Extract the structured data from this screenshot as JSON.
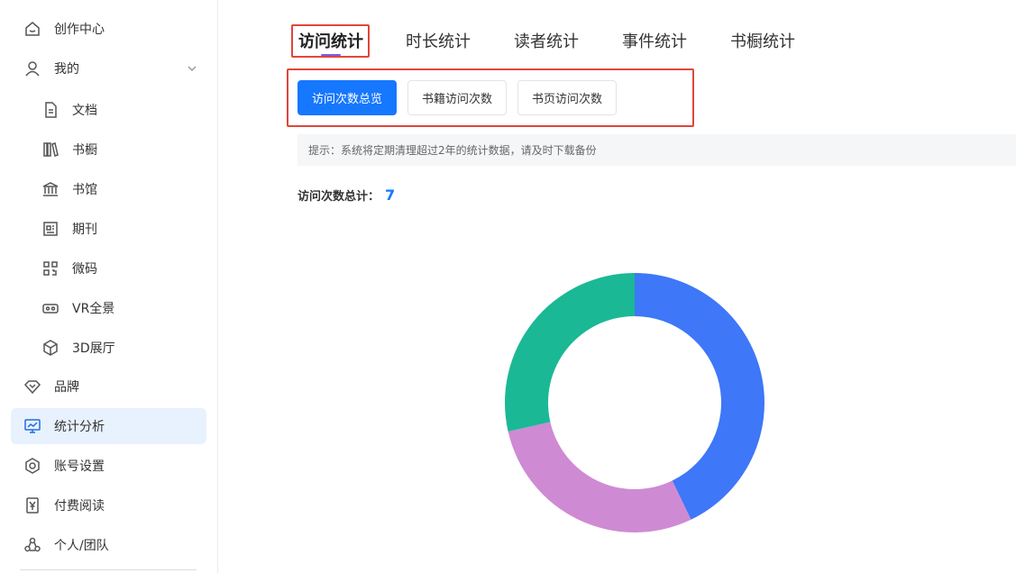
{
  "sidebar": {
    "items": [
      {
        "label": "创作中心",
        "icon": "home-icon"
      },
      {
        "label": "我的",
        "icon": "user-icon"
      },
      {
        "label": "文档",
        "icon": "document-icon"
      },
      {
        "label": "书橱",
        "icon": "bookshelf-icon"
      },
      {
        "label": "书馆",
        "icon": "library-icon"
      },
      {
        "label": "期刊",
        "icon": "journal-icon"
      },
      {
        "label": "微码",
        "icon": "qrcode-icon"
      },
      {
        "label": "VR全景",
        "icon": "vr-icon"
      },
      {
        "label": "3D展厅",
        "icon": "cube-icon"
      },
      {
        "label": "品牌",
        "icon": "diamond-icon"
      },
      {
        "label": "统计分析",
        "icon": "chart-monitor-icon"
      },
      {
        "label": "账号设置",
        "icon": "settings-icon"
      },
      {
        "label": "付费阅读",
        "icon": "yen-icon"
      },
      {
        "label": "个人/团队",
        "icon": "team-icon"
      }
    ],
    "active": "统计分析"
  },
  "tabs": [
    "访问统计",
    "时长统计",
    "读者统计",
    "事件统计",
    "书橱统计"
  ],
  "active_tab": "访问统计",
  "sub_buttons": [
    "访问次数总览",
    "书籍访问次数",
    "书页访问次数"
  ],
  "active_sub": "访问次数总览",
  "notice": "提示：系统将定期清理超过2年的统计数据，请及时下载备份",
  "total": {
    "label": "访问次数总计：",
    "value": "7"
  },
  "colors": {
    "primary": "#1677ff",
    "highlight": "#e0463a"
  },
  "chart_data": {
    "type": "pie",
    "donut": true,
    "slices": [
      {
        "value": 3,
        "color": "#3e77f7"
      },
      {
        "value": 2,
        "color": "#cf8ad4"
      },
      {
        "value": 2,
        "color": "#1bb896"
      }
    ]
  }
}
